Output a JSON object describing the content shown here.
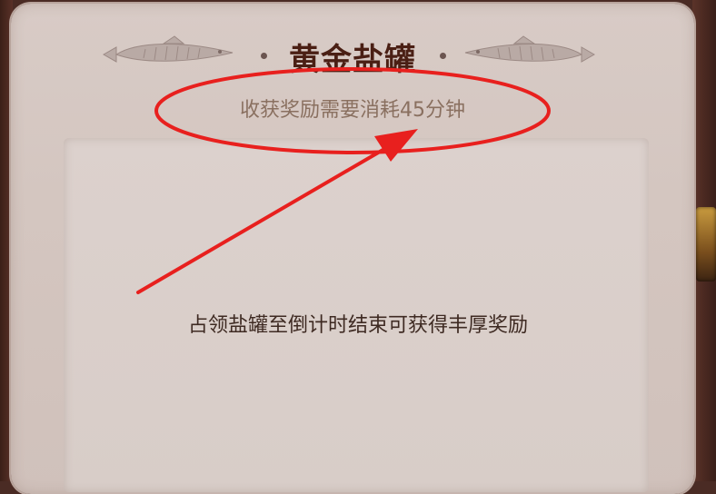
{
  "dialog": {
    "title": "黄金盐罐",
    "subtitle": "收获奖励需要消耗45分钟",
    "description": "占领盐罐至倒计时结束可获得丰厚奖励",
    "ornament_left_icon": "fish-ornament-icon",
    "ornament_right_icon": "fish-ornament-icon"
  },
  "annotation": {
    "color": "#e8201e"
  }
}
